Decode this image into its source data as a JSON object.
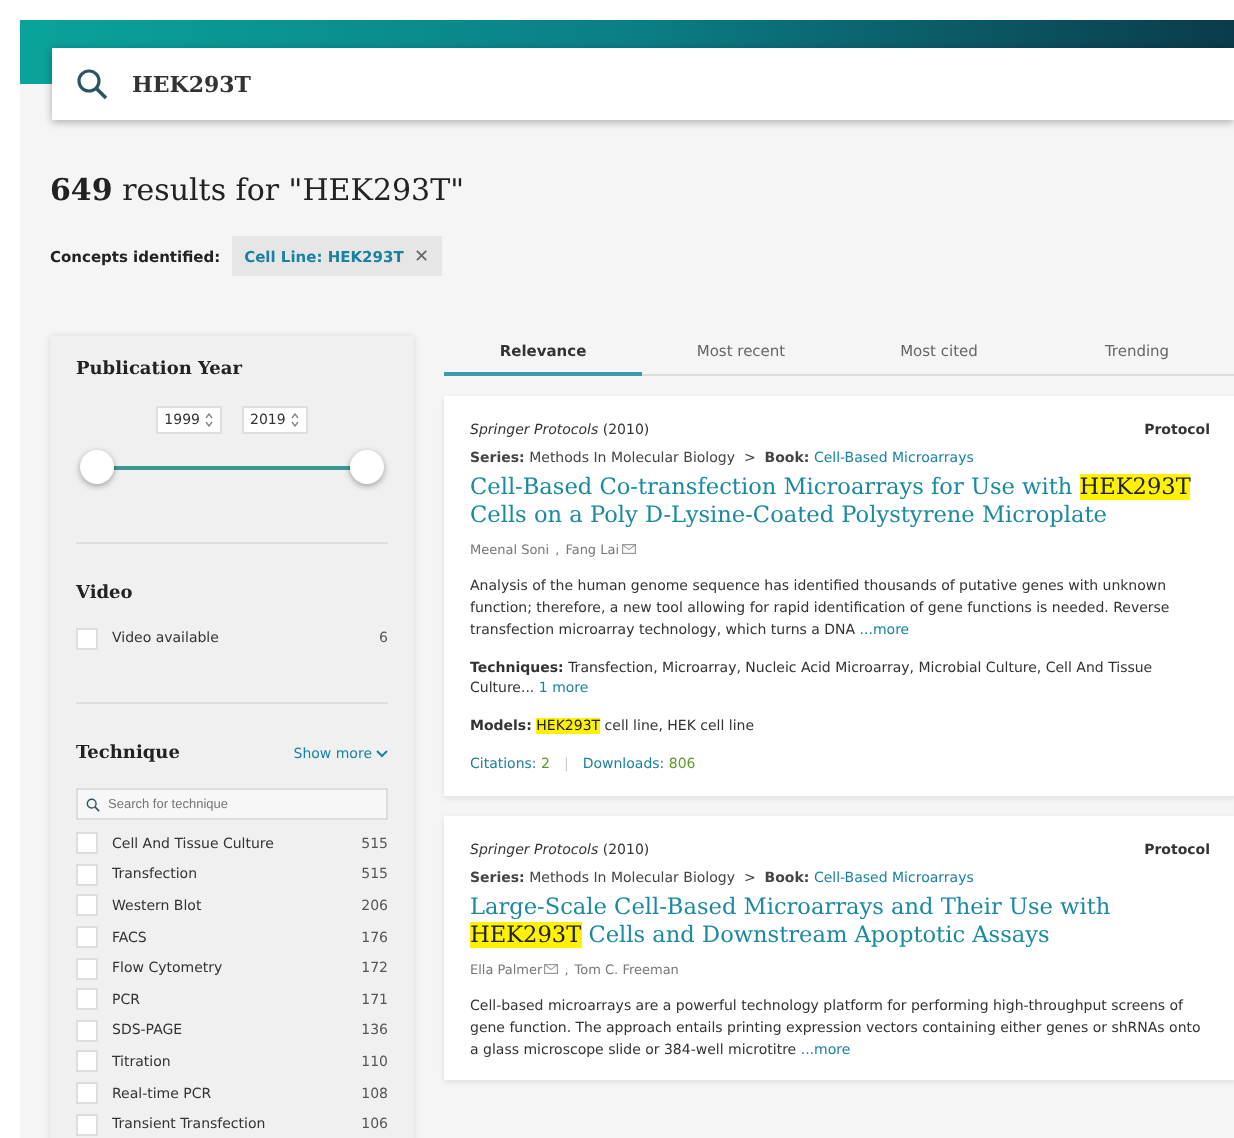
{
  "search": {
    "value": "HEK293T"
  },
  "results_heading": {
    "count": "649",
    "text": "results for \"HEK293T\""
  },
  "concepts": {
    "label": "Concepts identified:",
    "tags": [
      {
        "type": "Cell Line:",
        "value": "HEK293T",
        "remove": "✕"
      }
    ]
  },
  "filters": {
    "publication_year": {
      "title": "Publication Year",
      "from": "1999",
      "to": "2019",
      "handles": [
        {
          "level": 0
        },
        {
          "level": 1
        }
      ]
    },
    "video": {
      "title": "Video",
      "options": [
        {
          "label": "Video available",
          "count": "6",
          "checked": false
        }
      ]
    },
    "technique": {
      "title": "Technique",
      "show_more": "Show more",
      "search_placeholder": "Search for technique",
      "options": [
        {
          "label": "Cell And Tissue Culture",
          "count": "515",
          "checked": false
        },
        {
          "label": "Transfection",
          "count": "515",
          "checked": false
        },
        {
          "label": "Western Blot",
          "count": "206",
          "checked": false
        },
        {
          "label": "FACS",
          "count": "176",
          "checked": false
        },
        {
          "label": "Flow Cytometry",
          "count": "172",
          "checked": false
        },
        {
          "label": "PCR",
          "count": "171",
          "checked": false
        },
        {
          "label": "SDS-PAGE",
          "count": "136",
          "checked": false
        },
        {
          "label": "Titration",
          "count": "110",
          "checked": false
        },
        {
          "label": "Real-time PCR",
          "count": "108",
          "checked": false
        },
        {
          "label": "Transient Transfection",
          "count": "106",
          "checked": false
        }
      ]
    }
  },
  "sort_tabs": [
    {
      "label": "Relevance",
      "selected": true
    },
    {
      "label": "Most recent",
      "selected": false
    },
    {
      "label": "Most cited",
      "selected": false
    },
    {
      "label": "Trending",
      "selected": false
    }
  ],
  "results": [
    {
      "source": "Springer Protocols",
      "year": "(2010)",
      "type": "Protocol",
      "series_label": "Series:",
      "series": "Methods In Molecular Biology",
      "sep": ">",
      "book_label": "Book:",
      "book": "Cell-Based Microarrays",
      "title": [
        {
          "text": "Cell-Based Co-transfection Microarrays for Use with ",
          "highlight": false
        },
        {
          "text": "HEK293T",
          "highlight": true
        },
        {
          "text": " Cells on a Poly D-Lysine-Coated Polystyrene Microplate",
          "highlight": false
        }
      ],
      "authors": [
        {
          "name": "Meenal Soni",
          "email": false
        },
        {
          "name": "Fang Lai",
          "email": true
        }
      ],
      "author_sep": ",",
      "abstract": "Analysis of the human genome sequence has identified thousands of putative genes with unknown function; therefore, a new tool allowing for rapid identification of gene functions is needed. Reverse transfection microarray technology, which turns a DNA",
      "more": "...more",
      "techniques_label": "Techniques:",
      "techniques": "Transfection, Microarray, Nucleic Acid Microarray, Microbial Culture, Cell And Tissue Culture...",
      "techniques_more": "1 more",
      "models_label": "Models:",
      "models": [
        {
          "text": "HEK293T",
          "highlight": true
        },
        {
          "text": " cell line, HEK cell line",
          "highlight": false
        }
      ],
      "citations_label": "Citations:",
      "citations": "2",
      "stats_sep": "|",
      "downloads_label": "Downloads:",
      "downloads": "806"
    },
    {
      "source": "Springer Protocols",
      "year": "(2010)",
      "type": "Protocol",
      "series_label": "Series:",
      "series": "Methods In Molecular Biology",
      "sep": ">",
      "book_label": "Book:",
      "book": "Cell-Based Microarrays",
      "title": [
        {
          "text": "Large-Scale Cell-Based Microarrays and Their Use with ",
          "highlight": false
        },
        {
          "text": "HEK293T",
          "highlight": true
        },
        {
          "text": " Cells and Downstream Apoptotic Assays",
          "highlight": false
        }
      ],
      "authors": [
        {
          "name": "Ella Palmer",
          "email": true
        },
        {
          "name": "Tom C. Freeman",
          "email": false
        }
      ],
      "author_sep": ",",
      "abstract": "Cell-based microarrays are a powerful technology platform for performing high-throughput screens of gene function. The approach entails printing expression vectors containing either genes or shRNAs onto a glass microscope slide or 384-well microtitre",
      "more": "...more"
    }
  ]
}
